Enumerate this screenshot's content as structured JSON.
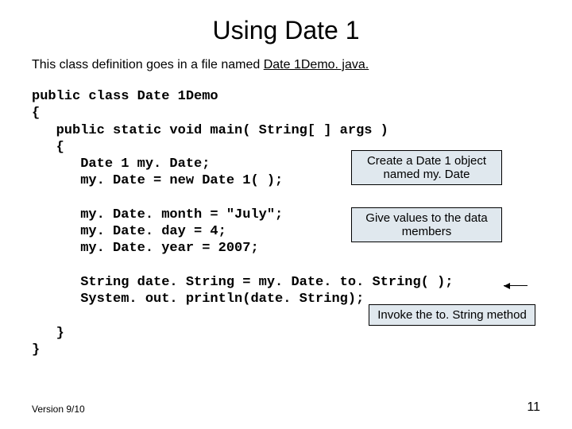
{
  "title": "Using Date 1",
  "subtitle_before": "This class definition goes in a file named ",
  "subtitle_file": "Date 1Demo. java.",
  "code": {
    "l1": "public class Date 1Demo",
    "l2": "{",
    "l3": "   public static void main( String[ ] args )",
    "l4": "   {",
    "l5": "      Date 1 my. Date;",
    "l6": "      my. Date = new Date 1( );",
    "l7": "",
    "l8": "      my. Date. month = \"July\";",
    "l9": "      my. Date. day = 4;",
    "l10": "      my. Date. year = 2007;",
    "l11": "",
    "l12": "      String date. String = my. Date. to. String( );",
    "l13": "      System. out. println(date. String);",
    "l14": "",
    "l15": "   }",
    "l16": "}"
  },
  "annotations": {
    "box1": "Create a Date 1 object named my. Date",
    "box2": "Give values to the data members",
    "box3": "Invoke the to. String method"
  },
  "footer": "Version 9/10",
  "page_num": "11"
}
